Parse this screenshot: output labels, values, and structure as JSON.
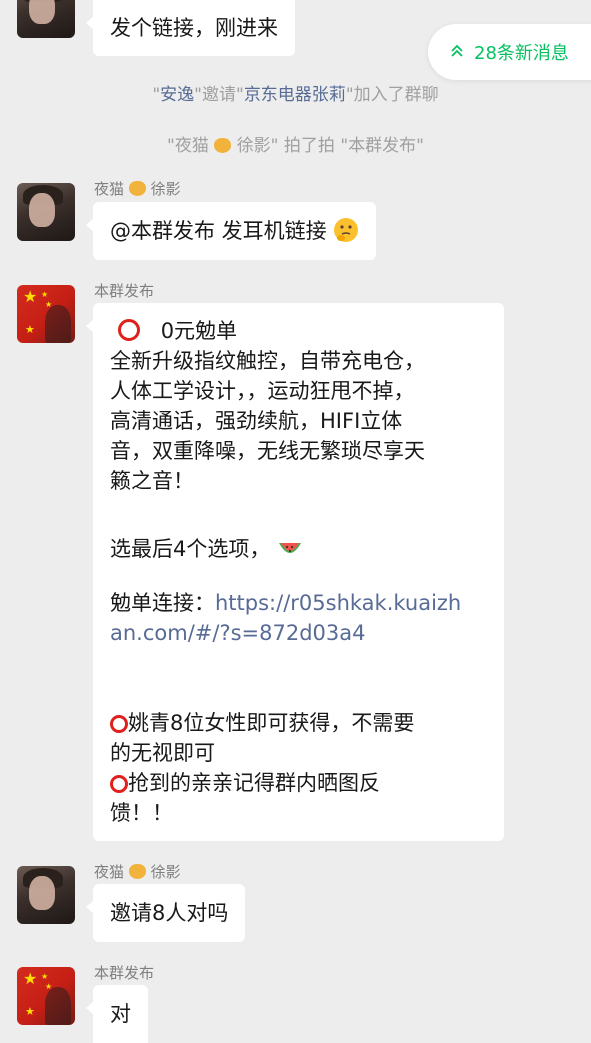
{
  "new_messages_pill": {
    "label": "28条新消息"
  },
  "messages": [
    {
      "sender": "",
      "text": "发个链接，刚进来"
    },
    {
      "sender": "夜猫",
      "sender_suffix": "徐影",
      "text": "@本群发布 发耳机链接"
    },
    {
      "sender": "本群发布",
      "title": "0元勉单",
      "lines": [
        "全新升级指纹触控，自带充电仓，",
        "人体工学设计，，运动狂甩不掉，",
        "高清通话，强劲续航，HIFI立体",
        "音，双重降噪，无线无繁琐尽享天",
        "籁之音！"
      ],
      "select_text": "选最后4个选项，",
      "link_label": "勉单连接：",
      "link_part1": "https://r05shkak.kuaizh",
      "link_part2": "an.com/#/?s=872d03a4",
      "note1_a": "姚青8位女性即可获得，不需要",
      "note1_b": "的无视即可",
      "note2_a": "抢到的亲亲记得群内晒图反",
      "note2_b": "馈！！"
    },
    {
      "sender": "夜猫",
      "sender_suffix": "徐影",
      "text": "邀请8人对吗"
    },
    {
      "sender": "本群发布",
      "text": "对"
    }
  ],
  "system_messages": {
    "invite": {
      "q1": "\"",
      "inviter": "安逸",
      "mid": "\"邀请\"",
      "invitee": "京东电器张莉",
      "tail": "\"加入了群聊"
    },
    "pat": {
      "part1": "\"夜猫",
      "part2": "徐影\" 拍了拍 \"本群发布\""
    }
  },
  "icons": {
    "pill": "double-chevron-up-icon",
    "thinking": "thinking-face-emoji",
    "watermelon": "watermelon-emoji",
    "circle": "red-circle-emoji",
    "cat": "cat-face-emoji"
  },
  "colors": {
    "accent_green": "#07c160",
    "link_blue": "#576b95",
    "background": "#ededed"
  }
}
